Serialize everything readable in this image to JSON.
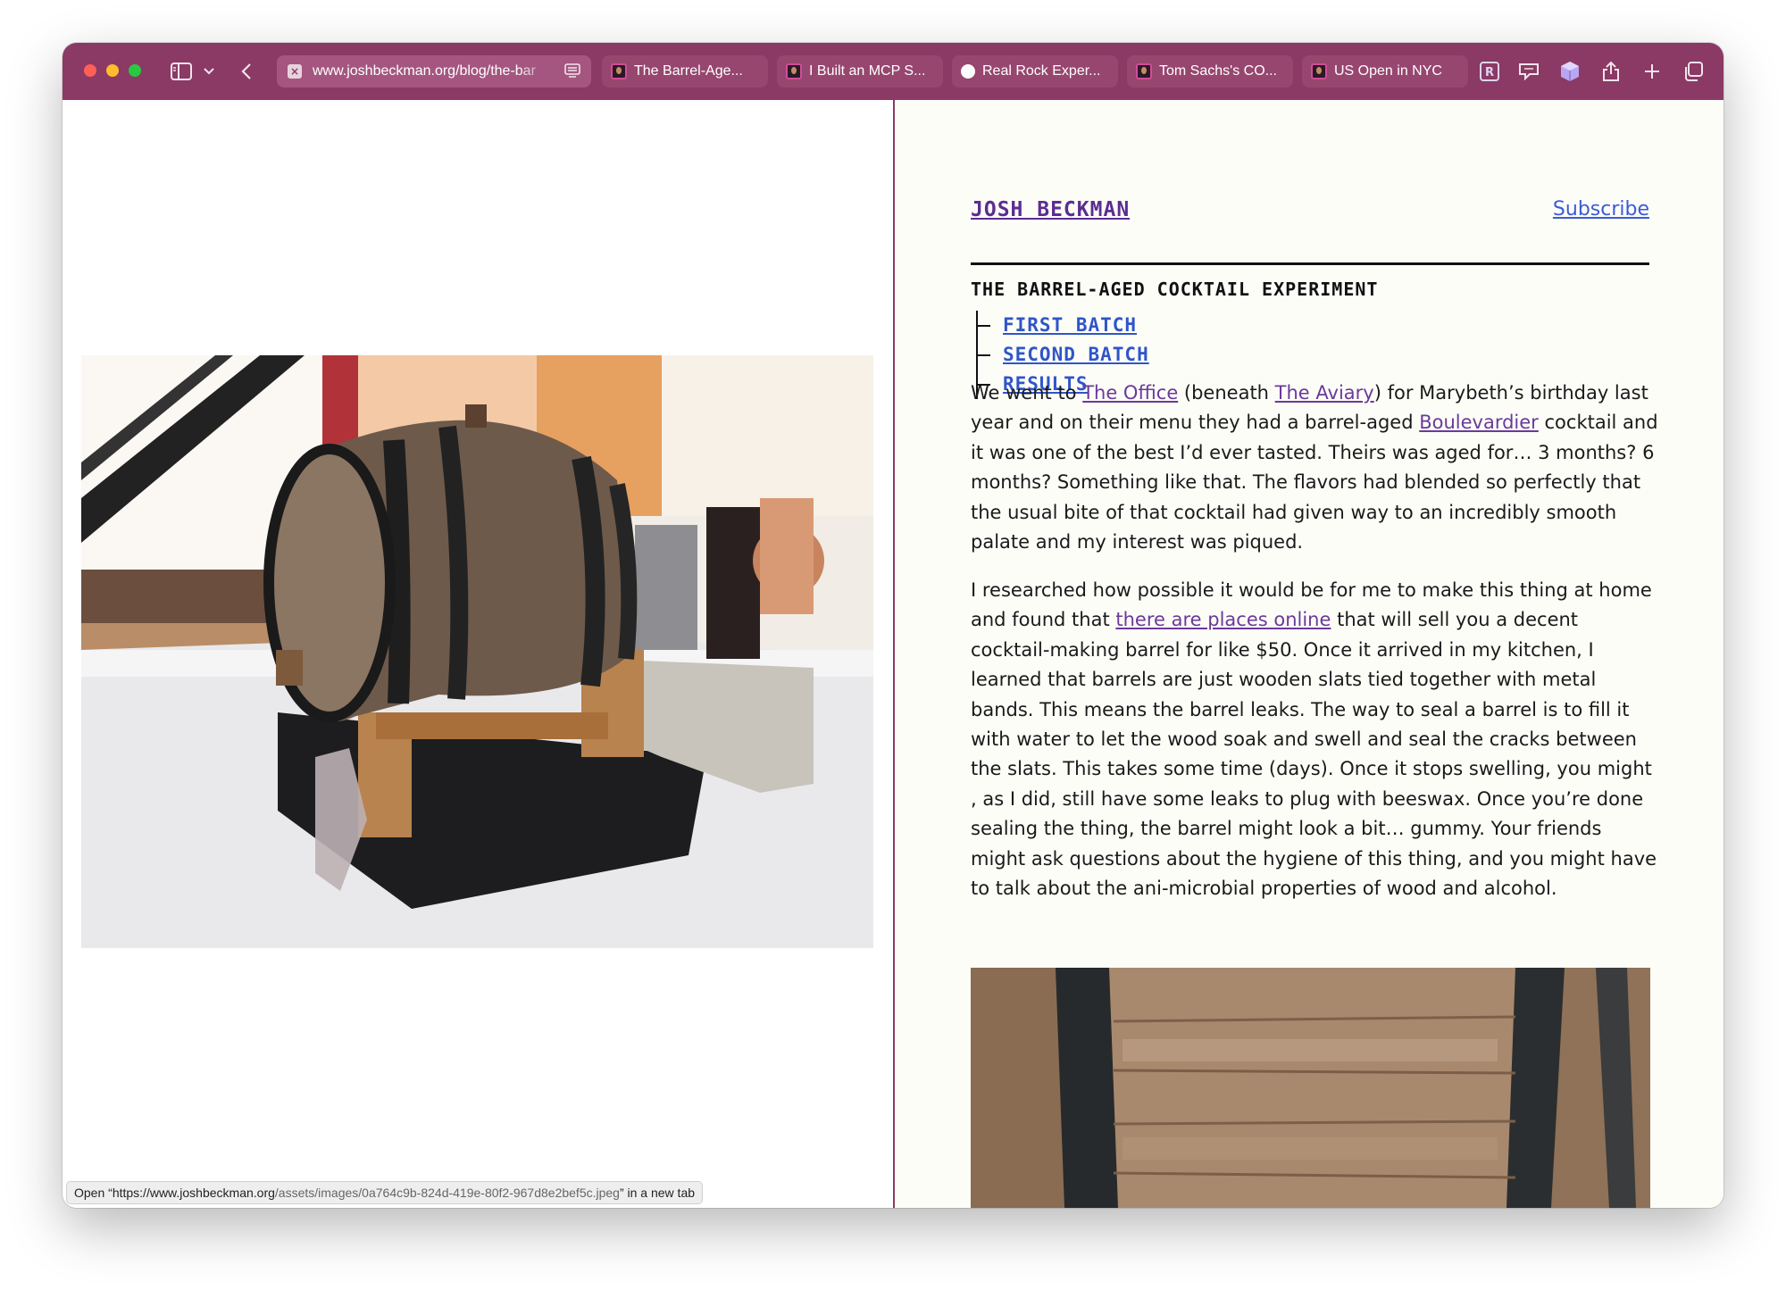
{
  "browser": {
    "url": "www.joshbeckman.org/blog/the-bar",
    "tabs": [
      {
        "label": "The Barrel-Age..."
      },
      {
        "label": "I Built an MCP S..."
      },
      {
        "label": "Real Rock Exper..."
      },
      {
        "label": "Tom Sachs's CO..."
      },
      {
        "label": "US Open in NYC"
      }
    ],
    "accent_color": "#8a3a64",
    "status_url_bold": "https://www.joshbeckman.org",
    "status_url_rest": "/assets/images/0a764c9b-824d-419e-80f2-967d8e2bef5c.jpeg",
    "status_prefix": "Open “",
    "status_suffix": "” in a new tab"
  },
  "site": {
    "title": "JOSH BECKMAN",
    "subscribe": "Subscribe",
    "link_color": "#3b5bd6",
    "title_color": "#5b2d91"
  },
  "post": {
    "title": "THE BARREL-AGED COCKTAIL EXPERIMENT",
    "toc": [
      "FIRST BATCH",
      "SECOND BATCH",
      "RESULTS"
    ],
    "p1": {
      "t1": "We went to ",
      "l1": "The Office",
      "t2": " (beneath ",
      "l2": "The Aviary",
      "t3": ") for Marybeth’s birthday last year and on their menu they had a barrel-aged ",
      "l3": "Boulevardier",
      "t4": " cocktail and it was one of the best I’d ever tasted. Theirs was aged for… 3 months? 6 months? Something like that. The flavors had blended so perfectly that the usual bite of that cocktail had given way to an incredibly smooth palate and my interest was piqued."
    },
    "p2": {
      "t1": "I researched how possible it would be for me to make this thing at home and found that ",
      "l1": "there are places online",
      "t2": " that will sell you a decent cocktail-making barrel for like $50. Once it arrived in my kitchen, I learned that barrels are just wooden slats tied together with metal bands. This means the barrel leaks. The way to seal a barrel is to fill it with water to let the wood soak and swell and seal the cracks between the slats. This takes some time (days). Once it stops swelling, you might , as I did, still have some leaks to plug with beeswax. Once you’re done sealing the thing, the barrel might look a bit… gummy. Your friends might ask questions about the hygiene of this thing, and you might have to talk about the ani-microbial properties of wood and alcohol."
    }
  }
}
